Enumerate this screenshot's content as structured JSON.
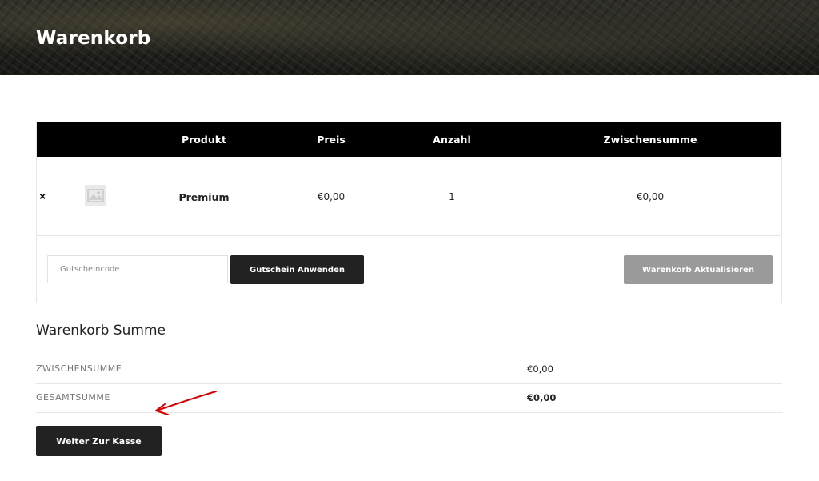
{
  "header": {
    "title": "Warenkorb"
  },
  "cart_table": {
    "columns": [
      "Produkt",
      "Preis",
      "Anzahl",
      "Zwischensumme"
    ],
    "rows": [
      {
        "remove_label": "×",
        "product": "Premium",
        "price": "€0,00",
        "quantity": "1",
        "subtotal": "€0,00"
      }
    ],
    "coupon": {
      "placeholder": "Gutscheincode",
      "value": ""
    },
    "apply_coupon_label": "Gutschein Anwenden",
    "update_cart_label": "Warenkorb Aktualisieren"
  },
  "cart_totals": {
    "title": "Warenkorb Summe",
    "rows": [
      {
        "label": "ZWISCHENSUMME",
        "value": "€0,00"
      },
      {
        "label": "GESAMTSUMME",
        "value": "€0,00"
      }
    ],
    "checkout_label": "Weiter Zur Kasse"
  },
  "annotation": {
    "arrow_color": "#d40000"
  }
}
